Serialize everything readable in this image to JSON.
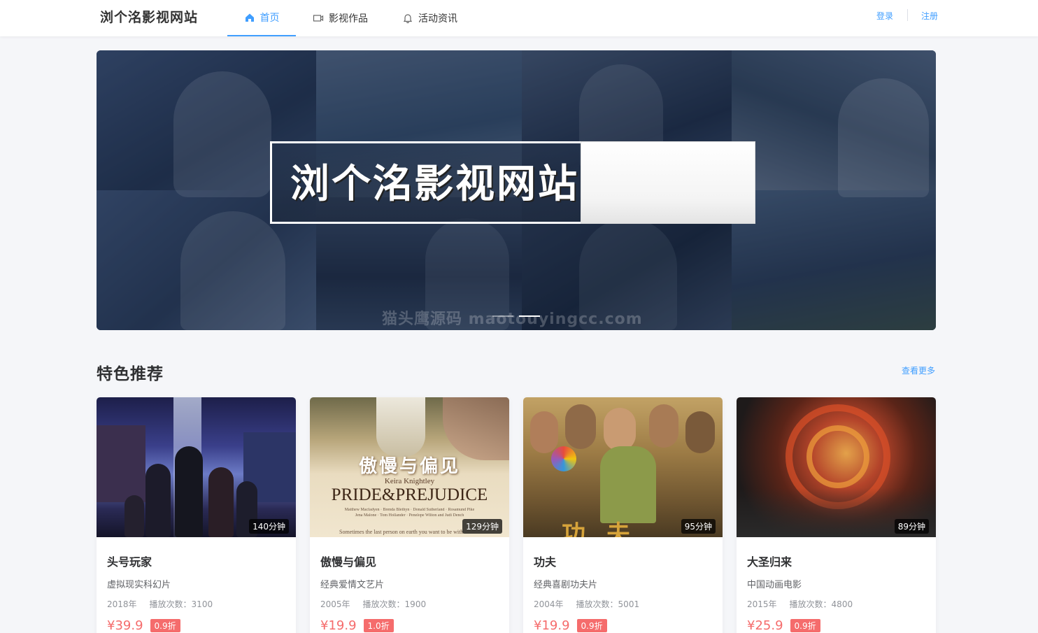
{
  "header": {
    "logo": "浏个洺影视网站",
    "nav": [
      {
        "label": "首页",
        "icon": "home-icon",
        "active": true
      },
      {
        "label": "影视作品",
        "icon": "video-camera-icon",
        "active": false
      },
      {
        "label": "活动资讯",
        "icon": "bell-icon",
        "active": false
      }
    ],
    "login": "登录",
    "register": "注册",
    "accent": "#409eff"
  },
  "banner": {
    "title": "浏个洺影视网站",
    "icon": "magnifier-icon",
    "watermark": "猫头鹰源码 maotouyingcc.com",
    "slides_total": 2,
    "active_slide": 2
  },
  "featured": {
    "title": "特色推荐",
    "more": "查看更多",
    "items": [
      {
        "title": "头号玩家",
        "desc": "虚拟现实科幻片",
        "year": "2018年",
        "plays": "播放次数：3100",
        "price": "¥39.9",
        "discount": "0.9折",
        "duration": "140分钟"
      },
      {
        "title": "傲慢与偏见",
        "desc": "经典爱情文艺片",
        "year": "2005年",
        "plays": "播放次数：1900",
        "price": "¥19.9",
        "discount": "1.0折",
        "duration": "129分钟",
        "poster_text": {
          "cn": "傲慢与偏见",
          "actor": "Keira Knightley",
          "en": "PRIDE&PREJUDICE",
          "cast": "Matthew Macfadyen · Brenda Blethyn · Donald Sutherland · Rosamund Pike",
          "cast2": "Jena Malone · Tom Hollander · Penelope Wilton and Judi Dench",
          "tagline": "Sometimes the last person on earth you want to be with"
        }
      },
      {
        "title": "功夫",
        "desc": "经典喜剧功夫片",
        "year": "2004年",
        "plays": "播放次数：5001",
        "price": "¥19.9",
        "discount": "0.9折",
        "duration": "95分钟",
        "poster_text": {
          "cn": "功夫"
        }
      },
      {
        "title": "大圣归来",
        "desc": "中国动画电影",
        "year": "2015年",
        "plays": "播放次数：4800",
        "price": "¥25.9",
        "discount": "0.9折",
        "duration": "89分钟"
      }
    ]
  },
  "colors": {
    "price": "#f56c6c",
    "page_bg": "#f5f6f9"
  }
}
